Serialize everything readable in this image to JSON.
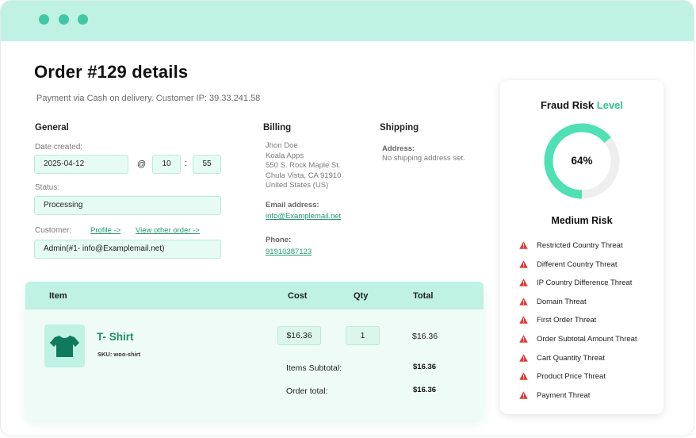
{
  "colors": {
    "accent": "#2ec495",
    "titlebar": "#bff2e3",
    "danger": "#e53935"
  },
  "order": {
    "title": "Order #129 details",
    "subtitle": "Payment via Cash on delivery. Customer IP: 39.33.241.58"
  },
  "general": {
    "heading": "General",
    "date_label": "Date created:",
    "date_value": "2025-04-12",
    "at_symbol": "@",
    "hour_value": "10",
    "colon": ":",
    "minute_value": "55",
    "status_label": "Status:",
    "status_value": "Processing",
    "customer_label": "Customer:",
    "profile_link": "Profile ->",
    "view_other_link": "View other order ->",
    "customer_value": "Admin(#1- info@Examplemail.net)"
  },
  "billing": {
    "heading": "Billing",
    "address_lines": [
      "Jhon Doe",
      "Koala Apps",
      "550 S. Rock Maple St.",
      "Chula Vista, CA 91910",
      "United States (US)"
    ],
    "email_label": "Email address:",
    "email_value": "info@Examplemail.net",
    "phone_label": "Phone:",
    "phone_value": "91910387123"
  },
  "shipping": {
    "heading": "Shipping",
    "address_label": "Address:",
    "address_value": "No shipping address set."
  },
  "items": {
    "headers": {
      "item": "Item",
      "cost": "Cost",
      "qty": "Qty",
      "total": "Total"
    },
    "product": {
      "icon": "tshirt-icon",
      "name": "T- Shirt",
      "sku": "SKU: woo-shirt",
      "cost": "$16.36",
      "qty": "1",
      "total": "$16.36"
    },
    "subtotal_label": "Items Subtotal:",
    "subtotal_value": "$16.36",
    "order_total_label": "Order total:",
    "order_total_value": "$16.36"
  },
  "fraud": {
    "title_main": "Fraud Risk",
    "title_accent": "Level",
    "percent": 64,
    "percent_label": "64%",
    "level": "Medium Risk",
    "threat_icon": "warning-triangle-icon",
    "threats": [
      "Restricted Country Threat",
      "Different Country Threat",
      "IP Country Difference Threat",
      "Domain Threat",
      "First Order Threat",
      "Order Subtotal Amount Threat",
      "Cart Quantity Threat",
      "Product Price Threat",
      "Payment Threat"
    ]
  }
}
